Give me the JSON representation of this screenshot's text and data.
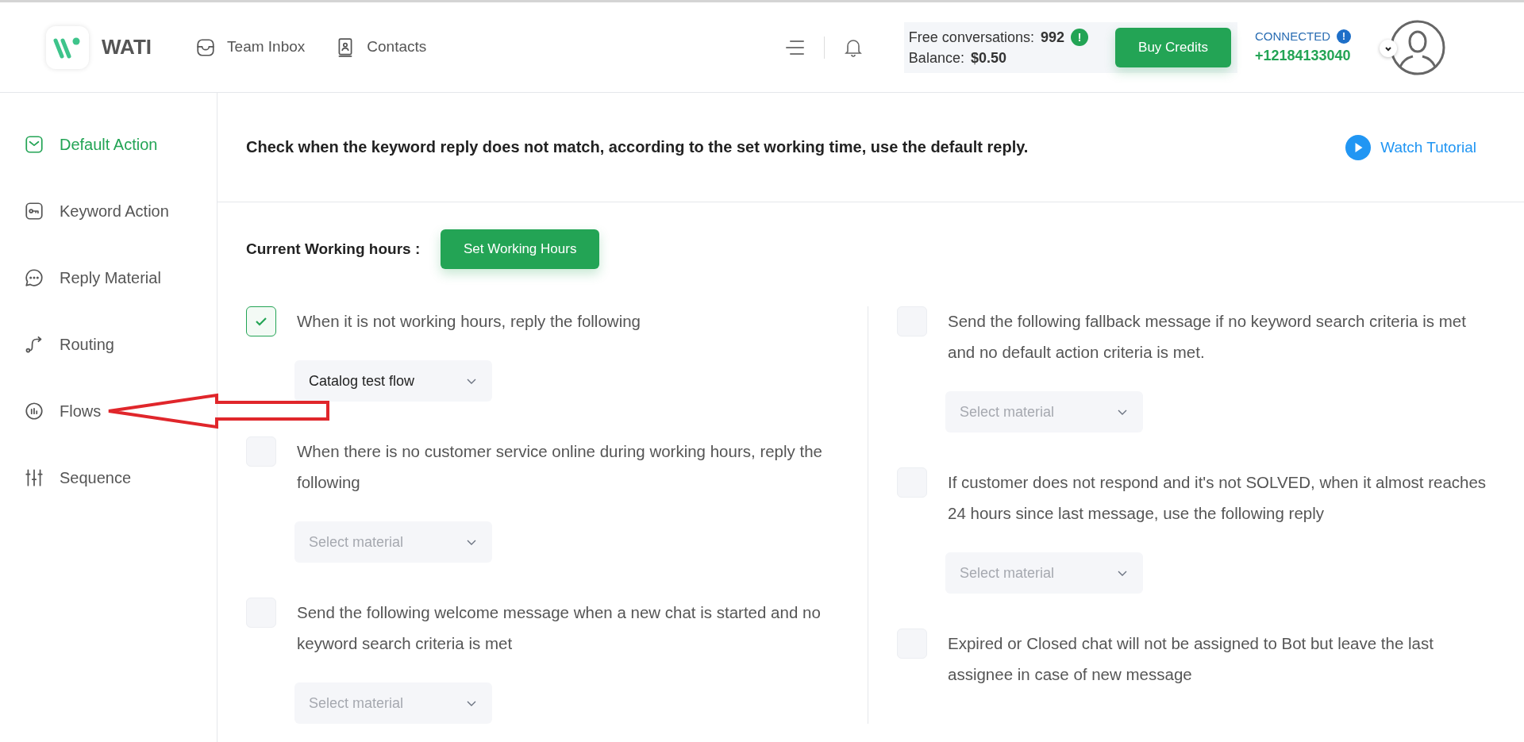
{
  "header": {
    "brand": "WATI",
    "nav": [
      {
        "label": "Team Inbox"
      },
      {
        "label": "Contacts"
      }
    ],
    "credits": {
      "free_label": "Free conversations:",
      "free_value": "992",
      "alert": "!",
      "balance_label": "Balance:",
      "balance_value": "$0.50"
    },
    "buy_button": "Buy Credits",
    "connection": {
      "status": "CONNECTED",
      "info": "!",
      "phone": "+12184133040"
    }
  },
  "sidebar": {
    "items": [
      {
        "label": "Default Action",
        "selected": true
      },
      {
        "label": "Keyword Action",
        "selected": false
      },
      {
        "label": "Reply Material",
        "selected": false
      },
      {
        "label": "Routing",
        "selected": false
      },
      {
        "label": "Flows",
        "selected": false
      },
      {
        "label": "Sequence",
        "selected": false
      }
    ]
  },
  "main": {
    "description": "Check when the keyword reply does not match, according to the set working time, use the default reply.",
    "tutorial": "Watch Tutorial",
    "working_hours_label": "Current Working hours :",
    "working_hours_button": "Set Working Hours",
    "left_options": [
      {
        "text": "When it is not working hours, reply the following",
        "checked": true,
        "dropdown": {
          "value": "Catalog test flow"
        }
      },
      {
        "text": "When there is no customer service online during working hours, reply the following",
        "checked": false,
        "dropdown": {
          "placeholder": "Select material"
        }
      },
      {
        "text": "Send the following welcome message when a new chat is started and no keyword search criteria is met",
        "checked": false,
        "dropdown": {
          "placeholder": "Select material"
        }
      }
    ],
    "right_options": [
      {
        "text": "Send the following fallback message if no keyword search criteria is met and no default action criteria is met.",
        "checked": false,
        "dropdown": {
          "placeholder": "Select material"
        }
      },
      {
        "text": "If customer does not respond and it's not SOLVED, when it almost reaches 24 hours since last message, use the following reply",
        "checked": false,
        "dropdown": {
          "placeholder": "Select material"
        }
      },
      {
        "text": "Expired or Closed chat will not be assigned to Bot but leave the last assignee in case of new message",
        "checked": false
      }
    ]
  }
}
